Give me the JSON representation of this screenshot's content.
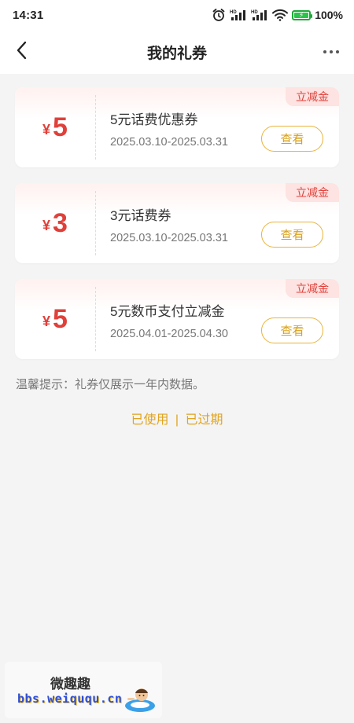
{
  "status_bar": {
    "time": "14:31",
    "battery_percent": "100%",
    "icons": [
      "alarm-icon",
      "hd-signal-icon",
      "hd-signal-icon",
      "wifi-icon",
      "battery-charging-icon"
    ]
  },
  "nav": {
    "title": "我的礼券",
    "back_icon": "chevron-left-icon",
    "more_icon": "more-dots-icon"
  },
  "coupons": [
    {
      "currency": "¥",
      "amount": "5",
      "name": "5元话费优惠券",
      "dates": "2025.03.10-2025.03.31",
      "tag": "立减金",
      "button": "查看"
    },
    {
      "currency": "¥",
      "amount": "3",
      "name": "3元话费券",
      "dates": "2025.03.10-2025.03.31",
      "tag": "立减金",
      "button": "查看"
    },
    {
      "currency": "¥",
      "amount": "5",
      "name": "5元数币支付立减金",
      "dates": "2025.04.01-2025.04.30",
      "tag": "立减金",
      "button": "查看"
    }
  ],
  "tip": "温馨提示：礼券仅展示一年内数据。",
  "history_links": {
    "used": "已使用",
    "separator": "|",
    "expired": "已过期"
  },
  "watermark": {
    "title": "微趣趣",
    "url": "bbs.weiququ.cn"
  },
  "colors": {
    "accent_red": "#e0403a",
    "accent_gold": "#e0a41e",
    "tag_bg": "#fde3e1",
    "page_bg": "#f4f4f4"
  }
}
